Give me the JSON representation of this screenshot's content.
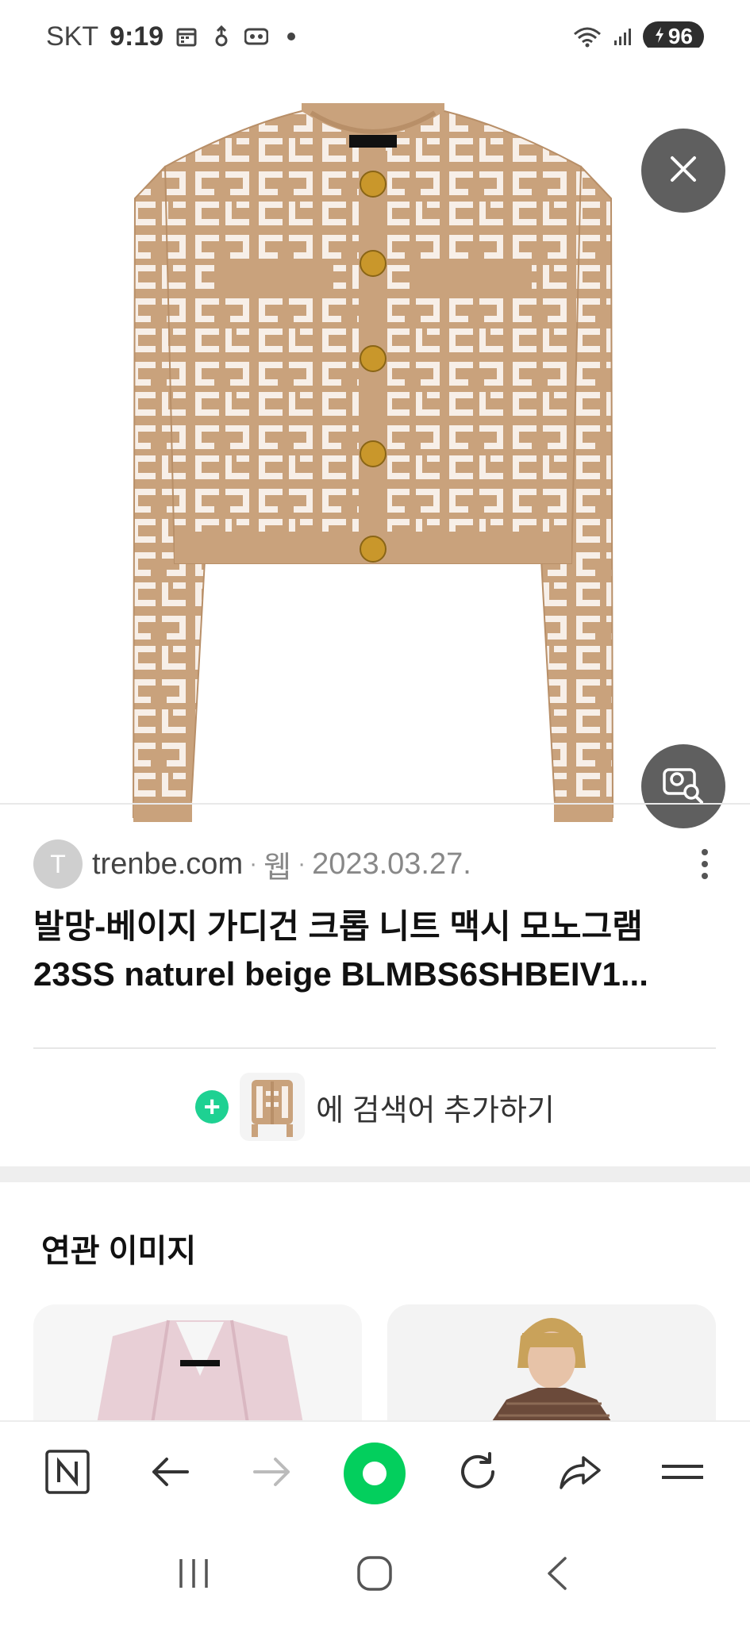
{
  "status_bar": {
    "carrier": "SKT",
    "time": "9:19",
    "battery_level": "96",
    "icons": [
      "calendar-icon",
      "notification-icon",
      "voicemail-icon",
      "dot-icon",
      "wifi-icon",
      "signal-icon",
      "battery-charging-icon"
    ]
  },
  "viewer": {
    "image_subject": "beige monogram cropped knit cardigan with gold buttons",
    "close_icon": "close-icon",
    "lens_icon": "image-search-icon",
    "colors": {
      "knit_tan": "#c9a27c",
      "knit_cream": "#f7efe8",
      "button_gold": "#c9972b",
      "overlay_button": "#5f5f5f"
    }
  },
  "result": {
    "favicon_letter": "T",
    "domain": "trenbe.com",
    "source_type": "웹",
    "date": "2023.03.27.",
    "separator": "·",
    "title_line1": "발망-베이지 가디건 크롭 니트 맥시 모노그램",
    "title_line2": "23SS naturel beige BLMBS6SHBEIV1...",
    "more_icon": "more-vertical-icon"
  },
  "add_keyword": {
    "plus": "+",
    "label": "에 검색어 추가하기",
    "accent": "#1ed192"
  },
  "related": {
    "title": "연관 이미지"
  },
  "toolbar": {
    "items": [
      "naver-home-icon",
      "back-arrow-icon",
      "forward-arrow-icon",
      "green-dot-button",
      "refresh-icon",
      "share-icon",
      "menu-icon"
    ],
    "accent": "#03cf5d",
    "home_letter": "N"
  },
  "system_nav": {
    "items": [
      "recent-apps-icon",
      "home-icon",
      "back-icon"
    ]
  }
}
